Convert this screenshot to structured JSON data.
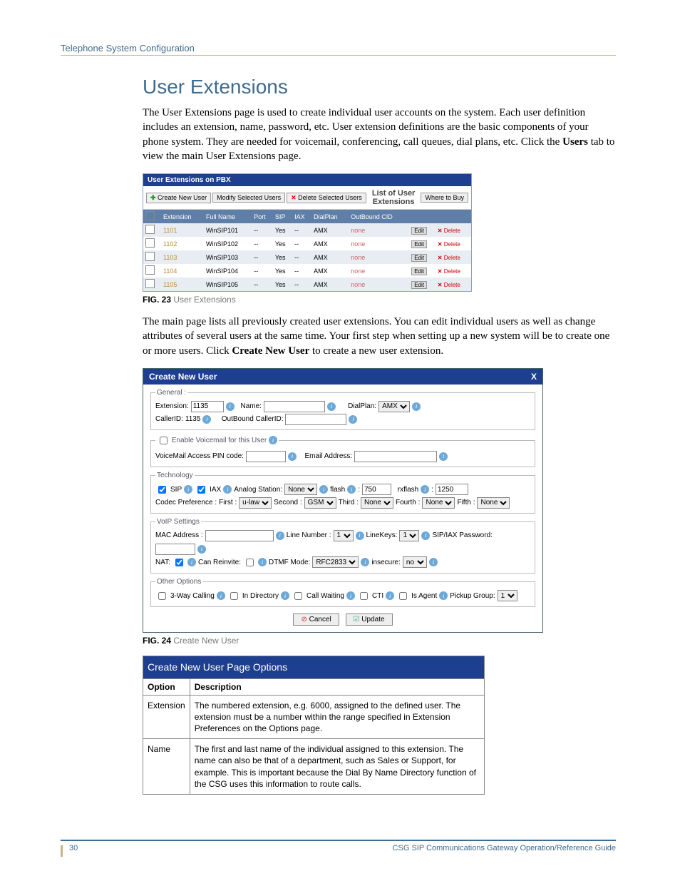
{
  "header": "Telephone System Configuration",
  "h1": "User Extensions",
  "p1": "The User Extensions page is used to create individual user accounts on the system. Each user definition includes an extension, name, password, etc. User extension definitions are the basic components of your phone system. They are needed for voicemail, conferencing, call queues, dial plans, etc. Click the ",
  "p1_bold": "Users",
  "p1_tail": " tab to view the main User Extensions page.",
  "fig23": {
    "num": "FIG. 23",
    "cap": "User Extensions"
  },
  "p2a": "The main page lists all previously created user extensions. You can edit individual users as well as change attributes of several users at the same time. Your first step when setting up a new system will be to create one or more users. Click ",
  "p2b": "Create New User",
  "p2c": " to create a new user extension.",
  "pbx": {
    "title": "User Extensions on PBX",
    "create": "Create New User",
    "modify": "Modify Selected Users",
    "delete": "Delete Selected Users",
    "listTitle": "List of User Extensions",
    "where": "Where to Buy",
    "cols": [
      "",
      "Extension",
      "Full Name",
      "Port",
      "SIP",
      "IAX",
      "DialPlan",
      "OutBound CID",
      "",
      ""
    ],
    "rows": [
      {
        "ext": "1101",
        "name": "WinSIP101",
        "port": "--",
        "sip": "Yes",
        "iax": "--",
        "dp": "AMX",
        "cid": "none"
      },
      {
        "ext": "1102",
        "name": "WinSIP102",
        "port": "--",
        "sip": "Yes",
        "iax": "--",
        "dp": "AMX",
        "cid": "none"
      },
      {
        "ext": "1103",
        "name": "WinSIP103",
        "port": "--",
        "sip": "Yes",
        "iax": "--",
        "dp": "AMX",
        "cid": "none"
      },
      {
        "ext": "1104",
        "name": "WinSIP104",
        "port": "--",
        "sip": "Yes",
        "iax": "--",
        "dp": "AMX",
        "cid": "none"
      },
      {
        "ext": "1105",
        "name": "WinSIP105",
        "port": "--",
        "sip": "Yes",
        "iax": "--",
        "dp": "AMX",
        "cid": "none"
      }
    ],
    "edit": "Edit",
    "del": "Delete"
  },
  "dlg": {
    "title": "Create New User",
    "x": "X",
    "general": "General :",
    "extension": "Extension:",
    "extVal": "1135",
    "name": "Name:",
    "dialplan": "DialPlan:",
    "dpVal": "AMX",
    "callerid": "CallerID:",
    "cidVal": "1135",
    "obcid": "OutBound CallerID:",
    "vmEnable": "Enable Voicemail for this User",
    "vmPin": "VoiceMail Access PIN code:",
    "email": "Email Address:",
    "tech": "Technology",
    "sip": "SIP",
    "iax": "IAX",
    "analog": "Analog Station:",
    "analogVal": "None",
    "flash": "flash",
    "flashVal": "750",
    "rxflash": "rxflash",
    "rxVal": "1250",
    "codec": "Codec Preference :",
    "first": "First :",
    "c1": "u-law",
    "second": "Second :",
    "c2": "GSM",
    "third": "Third :",
    "c3": "None",
    "fourth": "Fourth :",
    "c4": "None",
    "fifth": "Fifth :",
    "c5": "None",
    "voip": "VoIP Settings",
    "mac": "MAC Address :",
    "line": "Line Number :",
    "lineVal": "1",
    "lk": "LineKeys:",
    "lkVal": "1",
    "pw": "SIP/IAX Password:",
    "nat": "NAT:",
    "reinv": "Can Reinvite:",
    "dtmf": "DTMF Mode:",
    "dtmfVal": "RFC2833",
    "insec": "insecure:",
    "insecVal": "no",
    "other": "Other Options",
    "threeway": "3-Way Calling",
    "indir": "In Directory",
    "callwait": "Call Waiting",
    "cti": "CTI",
    "agent": "Is Agent",
    "pickup": "Pickup Group:",
    "pgVal": "1",
    "cancel": "Cancel",
    "update": "Update"
  },
  "fig24": {
    "num": "FIG. 24",
    "cap": "Create New User"
  },
  "optTable": {
    "title": "Create New User Page Options",
    "h1": "Option",
    "h2": "Description",
    "rows": [
      {
        "o": "Extension",
        "d": "The numbered extension, e.g. 6000, assigned to the defined user. The extension must be a number within the range specified in Extension Preferences on the Options page."
      },
      {
        "o": "Name",
        "d": "The first and last name of the individual assigned to this extension. The name can also be that of a department, such as Sales or Support, for example. This is important because the Dial By Name Directory function of the CSG uses this information to route calls."
      }
    ]
  },
  "footer": {
    "page": "30",
    "title": "CSG SIP Communications Gateway Operation/Reference Guide"
  }
}
